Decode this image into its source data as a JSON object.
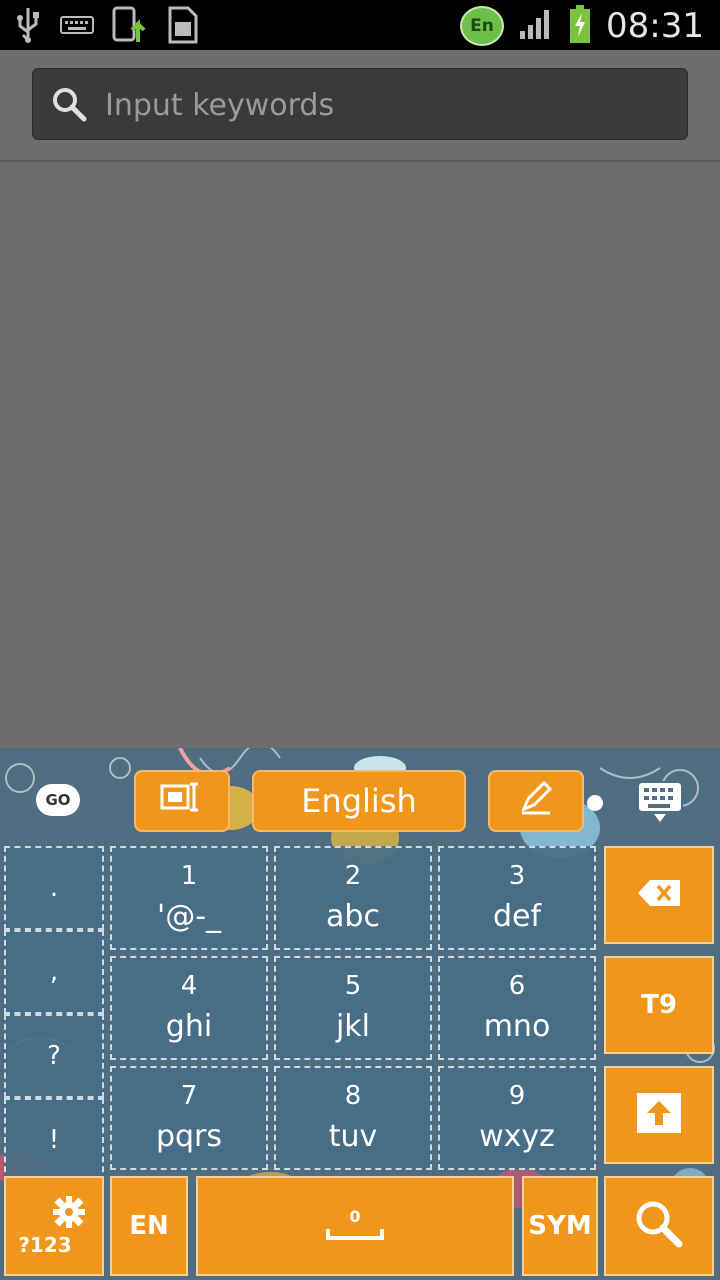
{
  "status_bar": {
    "time": "08:31",
    "language_badge": "En",
    "icons": [
      "usb-icon",
      "keyboard-icon",
      "upload-icon",
      "sd-card-icon",
      "signal-icon",
      "battery-charging-icon"
    ]
  },
  "search": {
    "placeholder": "Input keywords"
  },
  "keyboard": {
    "language_label": "English",
    "left_logo": "GO",
    "side_keys": [
      ".",
      ",",
      "?",
      "!"
    ],
    "keys": [
      {
        "num": "1",
        "letters": "'@-_"
      },
      {
        "num": "2",
        "letters": "abc"
      },
      {
        "num": "3",
        "letters": "def"
      },
      {
        "num": "4",
        "letters": "ghi"
      },
      {
        "num": "5",
        "letters": "jkl"
      },
      {
        "num": "6",
        "letters": "mno"
      },
      {
        "num": "7",
        "letters": "pqrs"
      },
      {
        "num": "8",
        "letters": "tuv"
      },
      {
        "num": "9",
        "letters": "wxyz"
      }
    ],
    "t9_label": "T9",
    "settings_label": "?123",
    "en_label": "EN",
    "space_label": "0",
    "sym_label": "SYM"
  },
  "colors": {
    "accent": "#f0961a",
    "keyboard_bg": "#4f6e82",
    "screen_bg": "#6e6e6e"
  }
}
